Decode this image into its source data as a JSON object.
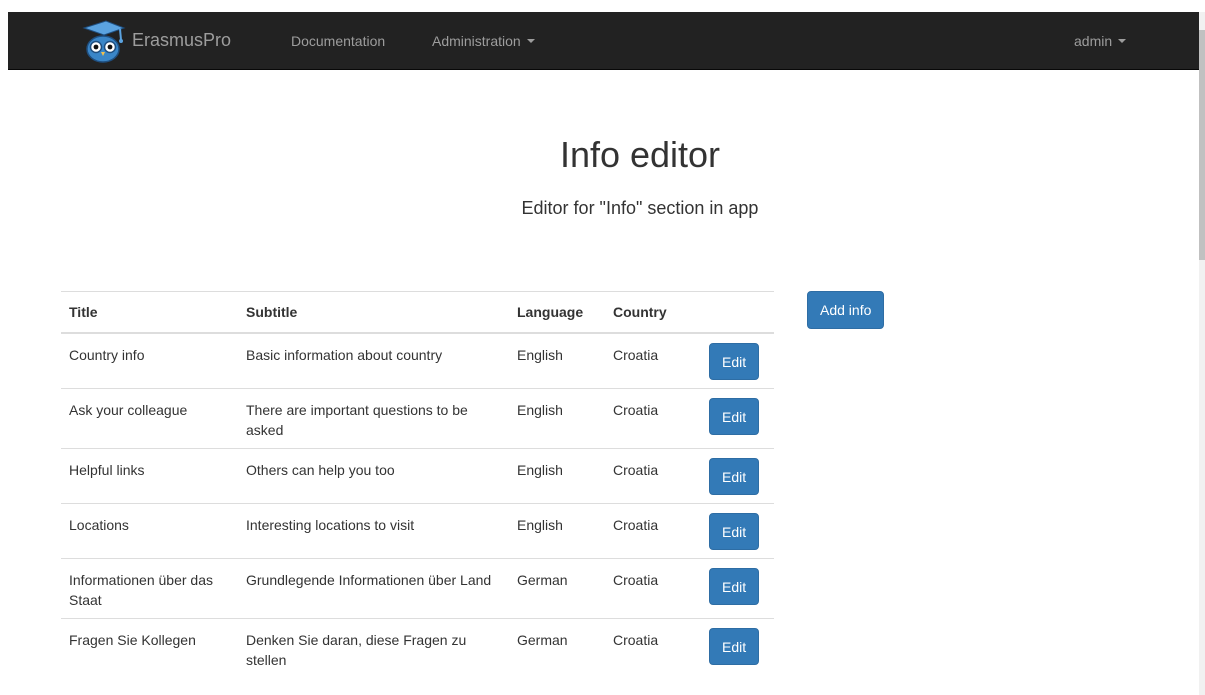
{
  "navbar": {
    "brand": "ErasmusPro",
    "links": [
      "Documentation",
      "Administration"
    ],
    "user": "admin"
  },
  "page": {
    "title": "Info editor",
    "subtitle": "Editor for \"Info\" section in app"
  },
  "actions": {
    "add_label": "Add info"
  },
  "table": {
    "columns": [
      "Title",
      "Subtitle",
      "Language",
      "Country"
    ],
    "edit_label": "Edit",
    "rows": [
      {
        "title": "Country info",
        "subtitle": "Basic information about country",
        "language": "English",
        "country": "Croatia"
      },
      {
        "title": "Ask your colleague",
        "subtitle": "There are important questions to be asked",
        "language": "English",
        "country": "Croatia"
      },
      {
        "title": "Helpful links",
        "subtitle": "Others can help you too",
        "language": "English",
        "country": "Croatia"
      },
      {
        "title": "Locations",
        "subtitle": "Interesting locations to visit",
        "language": "English",
        "country": "Croatia"
      },
      {
        "title": "Informationen über das Staat",
        "subtitle": "Grundlegende Informationen über Land",
        "language": "German",
        "country": "Croatia"
      },
      {
        "title": "Fragen Sie Kollegen",
        "subtitle": "Denken Sie daran, diese Fragen zu stellen",
        "language": "German",
        "country": "Croatia"
      }
    ]
  },
  "colors": {
    "navbar_bg": "#222222",
    "nav_text": "#9d9d9d",
    "primary": "#337ab7",
    "logo_blue": "#3a86c8"
  },
  "icons": {
    "brand": "owl-graduation-cap-icon",
    "dropdown": "caret-down-icon"
  }
}
